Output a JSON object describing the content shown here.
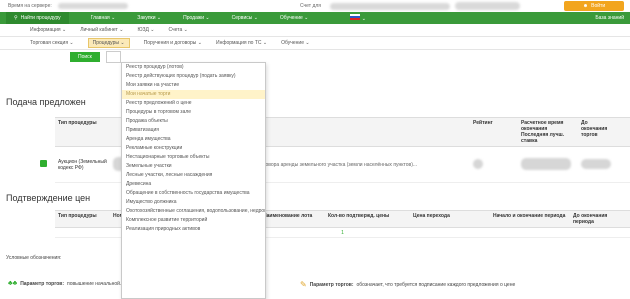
{
  "topbar": {
    "server_time_label": "Время на сервере:",
    "account_label": "Счет для",
    "login_button": "Войти"
  },
  "nav": {
    "search": "Найти процедуру",
    "items": [
      "Главная",
      "Закупки",
      "Продажи",
      "Сервисы",
      "Обучение"
    ],
    "knowledge": "База знаний"
  },
  "subnav1": [
    "Информация",
    "Личный кабинет",
    "ЮЗД",
    "Счета"
  ],
  "subnav2": [
    "Торговая секция",
    "Процедуры",
    "Поручения и договоры",
    "Информация по ТС",
    "Обучение"
  ],
  "toolbar": {
    "search_button": "Поиск"
  },
  "sections": {
    "bids": "Подача предложен",
    "price_confirm": "Подтверждение цен"
  },
  "table1": {
    "headers": [
      "Тип процедуры",
      "Наименование лота",
      "Рейтинг",
      "Расчетное время окончания Последняя лучш. ставка",
      "До окончания торгов"
    ],
    "row": {
      "type": "Аукцион (Земельный кодекс РФ)",
      "lot": "...на право заключения договора аренды земельного участка (земли населённых пунктов)..."
    }
  },
  "table2": {
    "headers": [
      "Тип процедуры",
      "Ном",
      "Наименование лота",
      "Кол-во подтвержд. цены",
      "Цена перехода",
      "Начало и окончание периода",
      "До окончания периода"
    ],
    "pager": "1"
  },
  "legend": {
    "title": "Условные обозначения:",
    "param1_label": "Параметр торгов:",
    "param1_text": "повышение начальной...",
    "param2_label": "Параметр торгов:",
    "param2_text": "обозначает, что требуется подписание каждого предложения о цене"
  },
  "dropdown": {
    "items": [
      "Реестр процедур (лотов)",
      "Реестр действующих процедур (подать заявку)",
      "Мои заявки на участие",
      "Мои начатые торги",
      "Реестр предложений о цене",
      "Процедуры в торговом зале",
      "Продажа объекты",
      "Приватизация",
      "Аренда имущества",
      "Рекламные конструкции",
      "Нестационарные торговые объекты",
      "Земельные участки",
      "Лесные участки, лесные насаждения",
      "Древесина",
      "Обращение в собственность государства имущества",
      "Имущество должника",
      "Охотохозяйственные соглашения, водопользование, недропользование",
      "Комплексное развитие территорий",
      "Реализация природных активов"
    ],
    "highlighted_index": 3
  }
}
